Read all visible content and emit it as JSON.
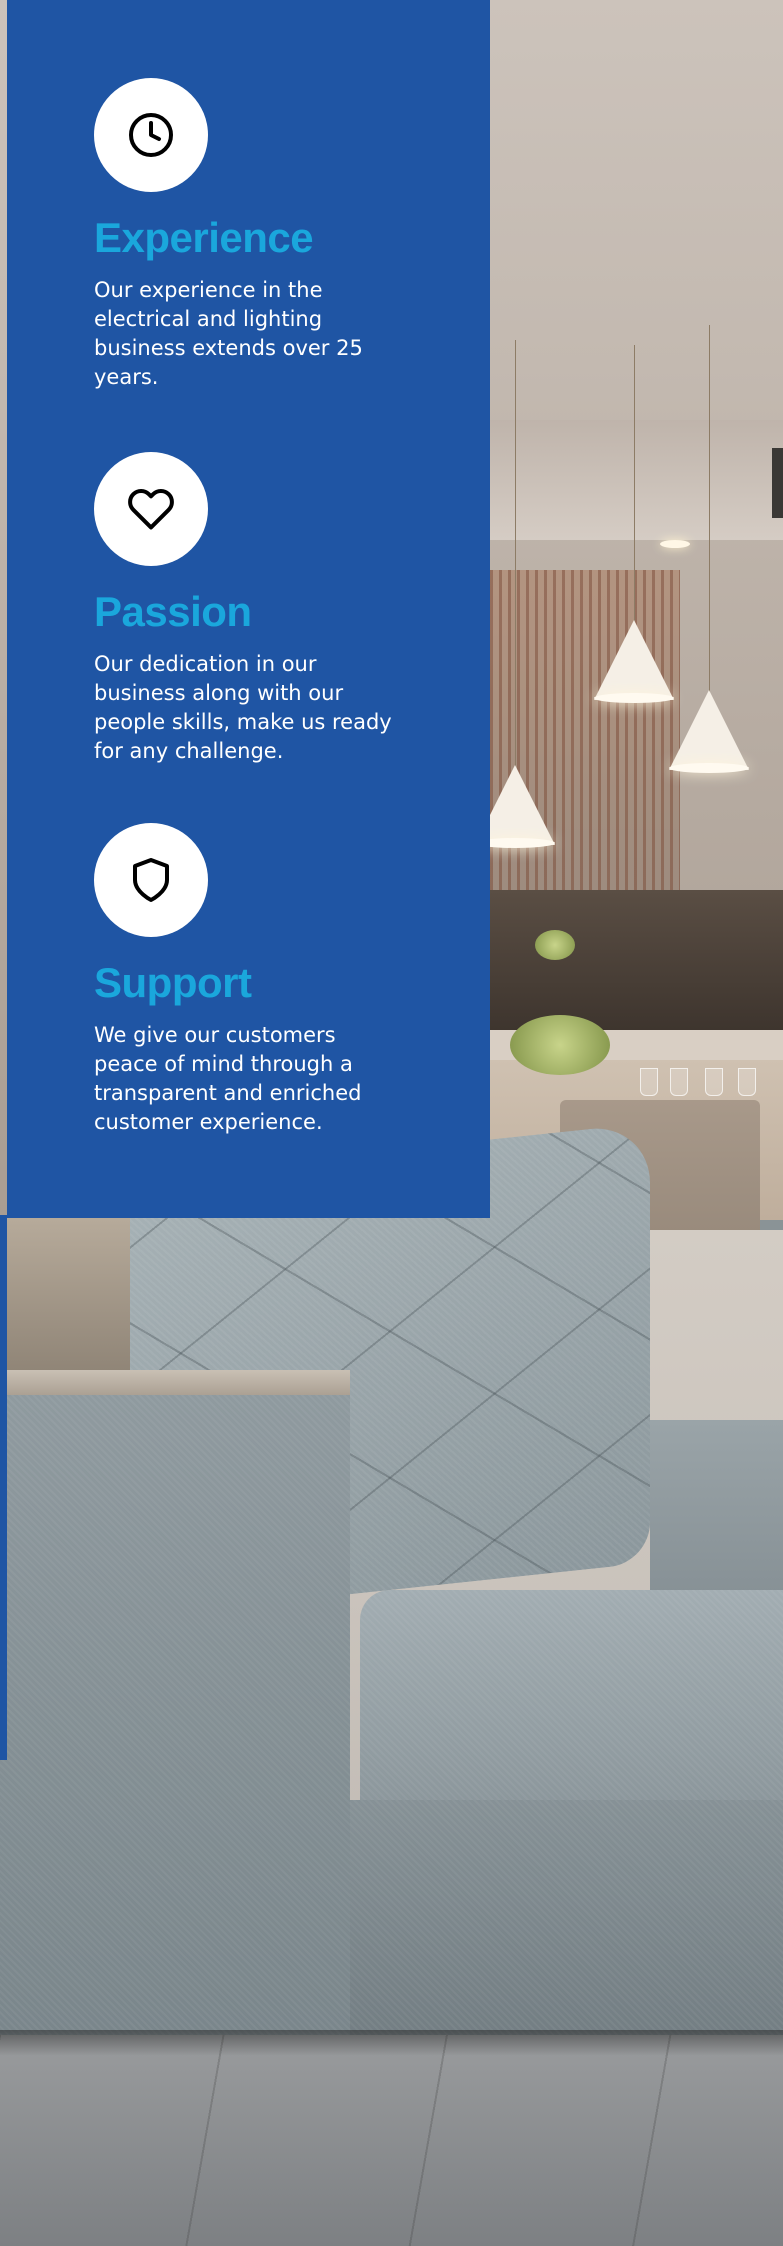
{
  "colors": {
    "panel_background": "#1f55a4",
    "title_accent": "#1aa7dc",
    "body_text": "#ffffff",
    "icon_circle": "#ffffff"
  },
  "features": [
    {
      "icon": "clock-icon",
      "title": "Experience",
      "text": "Our experience  in the electrical and lighting business extends over 25 years."
    },
    {
      "icon": "heart-icon",
      "title": "Passion",
      "text": "Our dedication in our business along with our people skills, make us ready for any challenge."
    },
    {
      "icon": "shield-icon",
      "title": "Support",
      "text": "We give our customers peace of mind through a transparent and enriched customer experience."
    }
  ]
}
